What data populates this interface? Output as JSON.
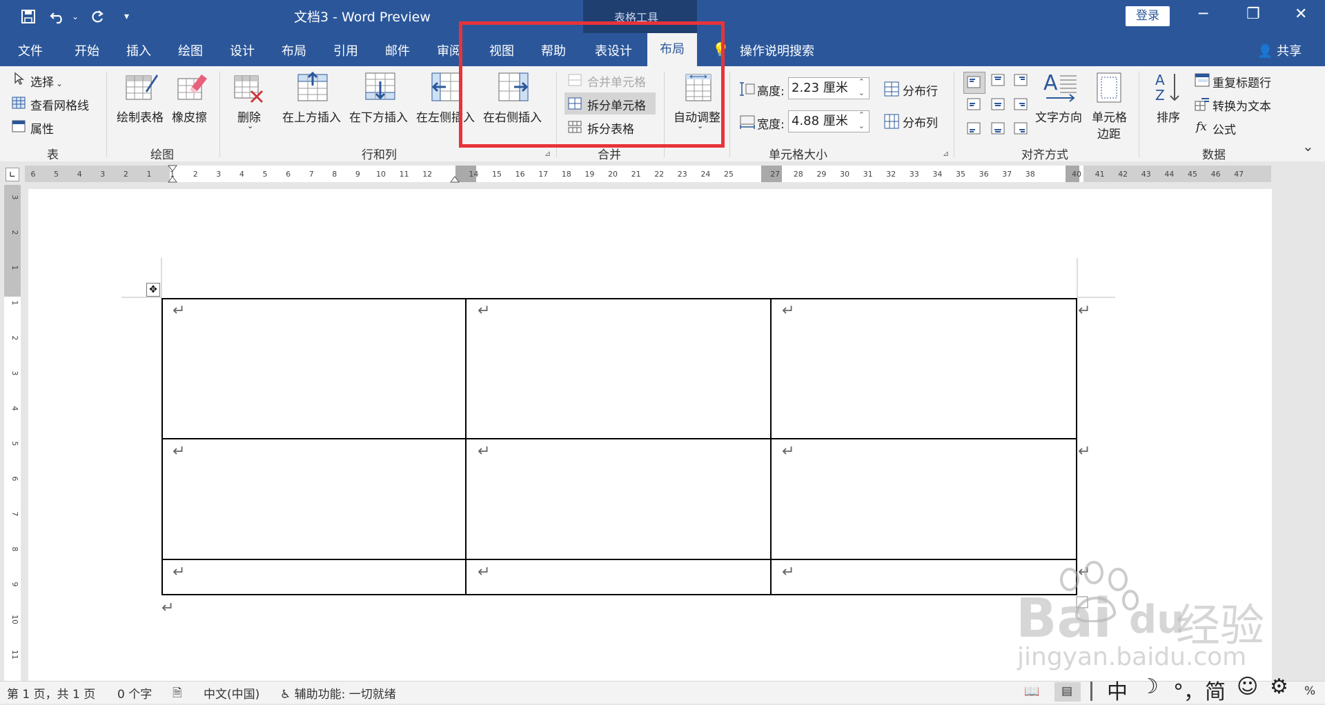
{
  "window": {
    "title": "文档3  -  Word Preview",
    "context_tools": "表格工具",
    "login": "登录",
    "share": "共享"
  },
  "tabs": [
    "文件",
    "开始",
    "插入",
    "绘图",
    "设计",
    "布局",
    "引用",
    "邮件",
    "审阅",
    "视图",
    "帮助",
    "表设计",
    "布局"
  ],
  "active_tab": "布局",
  "search": {
    "label": "操作说明搜索"
  },
  "ribbon": {
    "table": {
      "label": "表",
      "select": "选择",
      "view_gridlines": "查看网格线",
      "properties": "属性"
    },
    "draw": {
      "label": "绘图",
      "draw_table": "绘制表格",
      "eraser": "橡皮擦"
    },
    "rows_cols": {
      "label": "行和列",
      "delete": "删除",
      "insert_above": "在上方插入",
      "insert_below": "在下方插入",
      "insert_left": "在左侧插入",
      "insert_right": "在右侧插入"
    },
    "merge": {
      "label": "合并",
      "merge_cells": "合并单元格",
      "split_cells": "拆分单元格",
      "split_table": "拆分表格"
    },
    "autofit": {
      "label": "自动调整"
    },
    "cell_size": {
      "label": "单元格大小",
      "height_label": "高度:",
      "height_value": "2.23 厘米",
      "width_label": "宽度:",
      "width_value": "4.88 厘米",
      "distribute_rows": "分布行",
      "distribute_cols": "分布列"
    },
    "alignment": {
      "label": "对齐方式",
      "text_direction": "文字方向",
      "cell_margins_1": "单元格",
      "cell_margins_2": "边距"
    },
    "data": {
      "label": "数据",
      "sort": "排序",
      "repeat_header": "重复标题行",
      "convert_text": "转换为文本",
      "formula": "公式"
    }
  },
  "ruler_ticks": [
    "6",
    "5",
    "4",
    "3",
    "2",
    "1",
    "1",
    "2",
    "3",
    "4",
    "5",
    "6",
    "7",
    "8",
    "9",
    "10",
    "11",
    "12",
    "14",
    "15",
    "16",
    "17",
    "18",
    "19",
    "20",
    "21",
    "22",
    "23",
    "24",
    "25",
    "27",
    "28",
    "29",
    "30",
    "31",
    "32",
    "33",
    "34",
    "35",
    "36",
    "37",
    "38",
    "40",
    "41",
    "42",
    "43",
    "44",
    "45",
    "46",
    "47"
  ],
  "vruler_ticks": [
    "3",
    "2",
    "1",
    "1",
    "2",
    "3",
    "4",
    "5",
    "6",
    "7",
    "8",
    "9",
    "10",
    "11"
  ],
  "status": {
    "page": "第 1 页，共 1 页",
    "words": "0 个字",
    "language": "中文(中国)",
    "accessibility": "辅助功能: 一切就绪",
    "zoom_suffix": "%"
  },
  "ime": {
    "lang": "中",
    "punct": "°，",
    "simplified": "简"
  },
  "watermark": {
    "logo": "Bai",
    "logo2": "du",
    "brand": "经验",
    "url": "jingyan.baidu.com"
  }
}
